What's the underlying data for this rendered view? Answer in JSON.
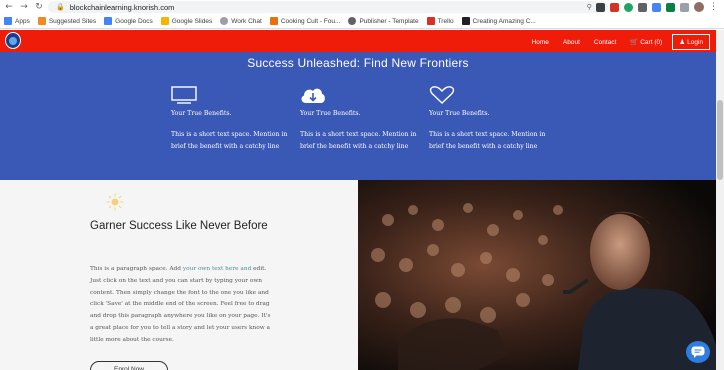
{
  "browser": {
    "url": "blockchainlearning.knorish.com",
    "bookmarks": [
      {
        "label": "Apps",
        "color": "#4285f4"
      },
      {
        "label": "Suggested Sites",
        "color": "#f08a24"
      },
      {
        "label": "Google Docs",
        "color": "#4285f4"
      },
      {
        "label": "Google Slides",
        "color": "#f4b400"
      },
      {
        "label": "Work Chat",
        "color": "#9aa0a6"
      },
      {
        "label": "Cooking Cult - Fou...",
        "color": "#e8710a"
      },
      {
        "label": "Publisher - Template",
        "color": "#5f6368"
      },
      {
        "label": "Trello",
        "color": "#d93025"
      },
      {
        "label": "Creating Amazing C...",
        "color": "#202124"
      }
    ]
  },
  "header": {
    "menu": [
      "Home",
      "About",
      "Contact"
    ],
    "cart": "Cart (0)",
    "login": "Login",
    "accent": "#ef1c0a"
  },
  "benefits": {
    "title": "Success Unleashed: Find New Frontiers",
    "background": "#3a58b6",
    "items": [
      {
        "icon": "monitor-icon",
        "heading": "Your True Benefits.",
        "text": "This is a short text space. Mention in brief the benefit with a catchy line"
      },
      {
        "icon": "cloud-download-icon",
        "heading": "Your True Benefits.",
        "text": "This is a short text space. Mention in brief the benefit with a catchy line"
      },
      {
        "icon": "heart-icon",
        "heading": "Your True Benefits.",
        "text": "This is a short text space. Mention in brief the benefit with a catchy line"
      }
    ]
  },
  "feature": {
    "heading": "Garner Success Like Never Before",
    "para_before": "This is a paragraph space. Add ",
    "para_link": "your own text here and",
    "para_after": " edit. Just click on the text and you can start by typing your own content. Then simply change the font to the one you like and click 'Save' at the middle end of the screen. Feel free to drag and drop this paragraph anywhere you like on your page. It's a great place for you to tell a story and let your users know a little more about the course.",
    "cta": "Enrol Now"
  }
}
